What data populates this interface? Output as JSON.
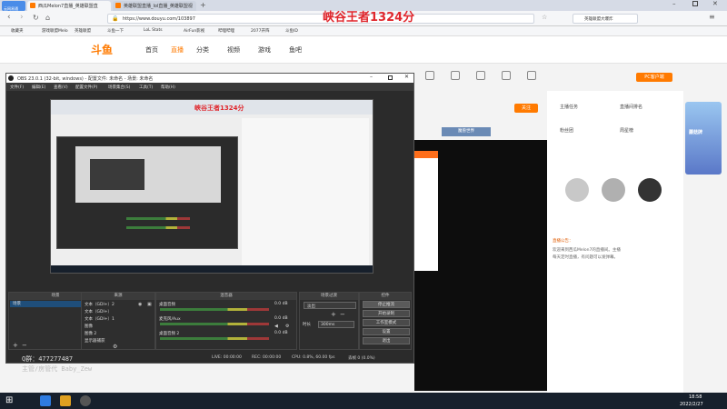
{
  "browser": {
    "logo_label": "云网易通",
    "tabs": [
      {
        "label": "西瓜Melon7直播_英雄联盟直"
      },
      {
        "label": "英雄联盟直播_lol直播_英雄联盟视"
      }
    ],
    "url": "https://www.douyu.com/103897",
    "overlay_title": "峡谷王者1324分",
    "search_label": "英雄联盟大爆炸",
    "bookmarks": [
      "收藏夹",
      "游戏联盟Melo",
      "英雄联盟",
      "斗鱼一下",
      "LoL Stats",
      "AirFun影视",
      "哔哩哔哩",
      "2077开阵",
      "斗鱼ID"
    ]
  },
  "site": {
    "logo": "斗鱼",
    "nav": [
      "首页",
      "直播",
      "分类",
      "视频",
      "游戏",
      "鱼吧"
    ],
    "download_button": "PC客户端",
    "follow_button": "关注",
    "badge_label": "魔兽世界",
    "side_labels": [
      "主播任务",
      "直播间排名",
      "粉丝团",
      "周星榜"
    ],
    "chat_lines": [
      "直播公告：",
      "欢迎来到西瓜Melon7的直播间。主播",
      "每天定时直播，有问题可以发弹幕。"
    ],
    "banner_text": "蘑菇牌"
  },
  "obs": {
    "title": "OBS 23.0.1 (32-bit, windows) - 配置文件: 未命名 - 场景: 未命名",
    "menu": [
      "文件(F)",
      "编辑(E)",
      "查看(V)",
      "配置文件(P)",
      "场景集合(S)",
      "工具(T)",
      "帮助(H)"
    ],
    "preview_title": "峡谷王者1324分",
    "docks": {
      "scenes": "场景",
      "sources": "来源",
      "mixer": "混音器",
      "transitions": "场景过渡",
      "controls": "控件"
    },
    "scene_item": "场景",
    "sources": [
      "文本（GDI+）2",
      "文本（GDI+）",
      "文本（GDI+）1",
      "图像",
      "图像 2",
      "显示器捕获"
    ],
    "mixer": [
      {
        "name": "桌面音频",
        "db": "0.0 dB"
      },
      {
        "name": "麦克风/Aux",
        "db": "0.0 dB"
      },
      {
        "name": "桌面音频 2",
        "db": "0.0 dB"
      }
    ],
    "transition": "淡出",
    "duration_label": "时长",
    "duration": "300ms",
    "control_buttons": [
      "停止推流",
      "开始录制",
      "工作室模式",
      "设置",
      "退出"
    ],
    "status": {
      "live": "LIVE: 00:00:00",
      "rec": "REC: 00:00:00",
      "cpu": "CPU: 0.8%, 60.00 fps",
      "dropped": "丢帧 0 (0.0%)"
    }
  },
  "overlay": {
    "qq": "Q群：477277487",
    "moderator": "主管/房管代 Baby_Zew"
  },
  "taskbar": {
    "time": "18:58",
    "date": "2022/2/27"
  }
}
